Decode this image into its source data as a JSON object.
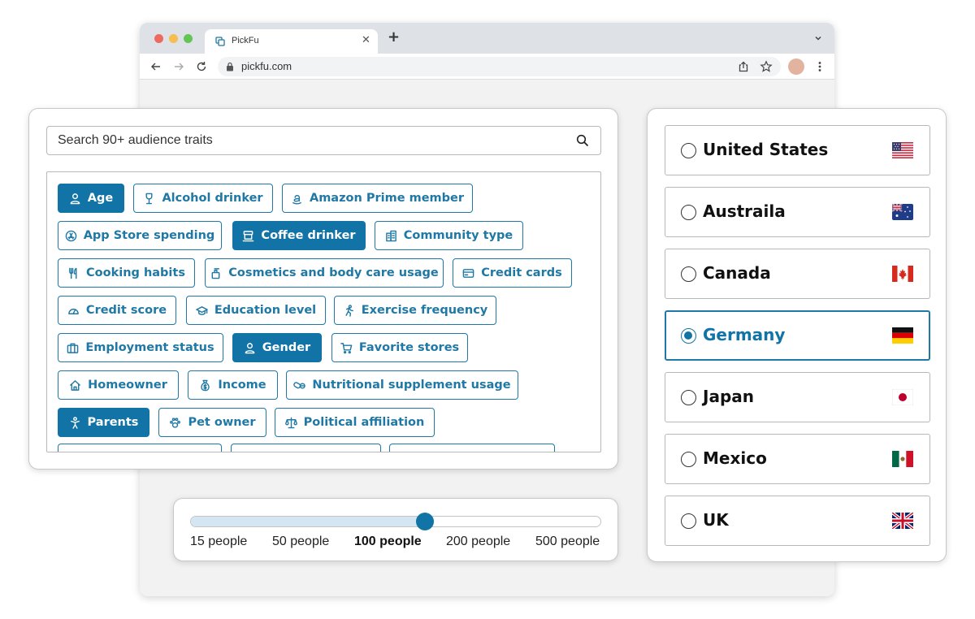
{
  "browser": {
    "tab_title": "PickFu",
    "tab_close": "✕",
    "new_tab": "+",
    "url": "pickfu.com"
  },
  "traits": {
    "search_placeholder": "Search 90+ audience traits",
    "chips": [
      {
        "label": "Age",
        "icon": "person-icon",
        "selected": true
      },
      {
        "label": "Alcohol drinker",
        "icon": "wine-glass-icon",
        "selected": false
      },
      {
        "label": "Amazon Prime member",
        "icon": "amazon-icon",
        "selected": false
      },
      {
        "label": "App Store spending",
        "icon": "app-store-icon",
        "selected": false
      },
      {
        "label": "Coffee drinker",
        "icon": "coffee-icon",
        "selected": true
      },
      {
        "label": "Community type",
        "icon": "buildings-icon",
        "selected": false
      },
      {
        "label": "Cooking habits",
        "icon": "utensils-icon",
        "selected": false
      },
      {
        "label": "Cosmetics and body care usage",
        "icon": "lotion-icon",
        "selected": false
      },
      {
        "label": "Credit cards",
        "icon": "credit-card-icon",
        "selected": false
      },
      {
        "label": "Credit score",
        "icon": "gauge-icon",
        "selected": false
      },
      {
        "label": "Education level",
        "icon": "graduation-cap-icon",
        "selected": false
      },
      {
        "label": "Exercise frequency",
        "icon": "running-icon",
        "selected": false
      },
      {
        "label": "Employment status",
        "icon": "briefcase-icon",
        "selected": false
      },
      {
        "label": "Gender",
        "icon": "person-icon",
        "selected": true
      },
      {
        "label": "Favorite stores",
        "icon": "cart-icon",
        "selected": false
      },
      {
        "label": "Homeowner",
        "icon": "house-icon",
        "selected": false
      },
      {
        "label": "Income",
        "icon": "money-bag-icon",
        "selected": false
      },
      {
        "label": "Nutritional supplement usage",
        "icon": "pills-icon",
        "selected": false
      },
      {
        "label": "Parents",
        "icon": "child-icon",
        "selected": true
      },
      {
        "label": "Pet owner",
        "icon": "paw-icon",
        "selected": false
      },
      {
        "label": "Political affiliation",
        "icon": "scales-icon",
        "selected": false
      }
    ]
  },
  "sample_size": {
    "options": [
      "15 people",
      "50 people",
      "100 people",
      "200 people",
      "500 people"
    ],
    "selected": "100 people",
    "selected_index": 2
  },
  "countries": {
    "items": [
      {
        "name": "United States",
        "flag": "us-flag-icon",
        "selected": false
      },
      {
        "name": "Australia",
        "display": "Austraila",
        "flag": "australia-flag-icon",
        "selected": false
      },
      {
        "name": "Canada",
        "flag": "canada-flag-icon",
        "selected": false
      },
      {
        "name": "Germany",
        "flag": "germany-flag-icon",
        "selected": true
      },
      {
        "name": "Japan",
        "flag": "japan-flag-icon",
        "selected": false
      },
      {
        "name": "Mexico",
        "flag": "mexico-flag-icon",
        "selected": false
      },
      {
        "name": "UK",
        "flag": "uk-flag-icon",
        "selected": false
      }
    ]
  },
  "colors": {
    "accent": "#1274a6",
    "accent_border": "#1f78a5",
    "slider_fill": "#d3e6f1"
  }
}
